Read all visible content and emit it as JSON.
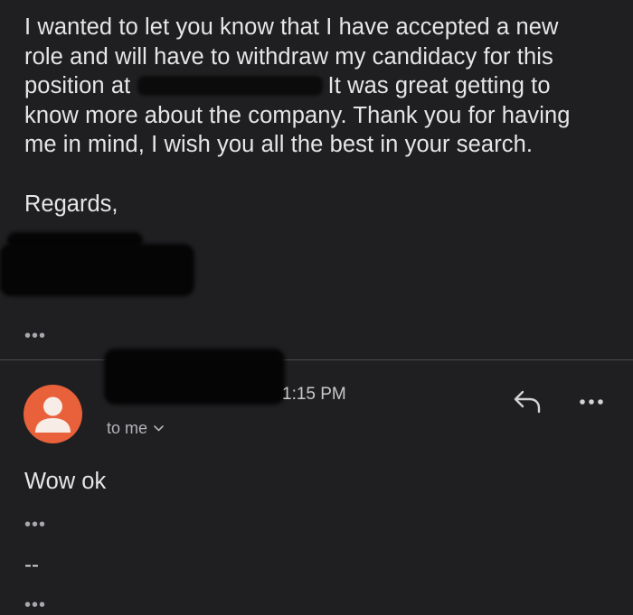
{
  "previous_message": {
    "lines": [
      "I wanted to let you know that I have accepted a new",
      "role and will have to withdraw my candidacy for this",
      "position at",
      "It was great getting to",
      "know more about the company. Thank you for having",
      "me in mind, I wish you all the best in your search."
    ],
    "closing": "Regards,",
    "expand_label": "•••"
  },
  "reply_header": {
    "time": "1:15 PM",
    "recipient_label": "to me",
    "avatar_color": "#e8613a"
  },
  "reply_message": {
    "body": "Wow ok",
    "expand_label": "•••",
    "signature_separator": "--",
    "signature_expand_label": "•••"
  },
  "icons": {
    "reply": "reply-arrow-icon",
    "more": "more-horizontal-icon",
    "chevron": "chevron-down-icon",
    "avatar": "person-avatar-icon"
  }
}
